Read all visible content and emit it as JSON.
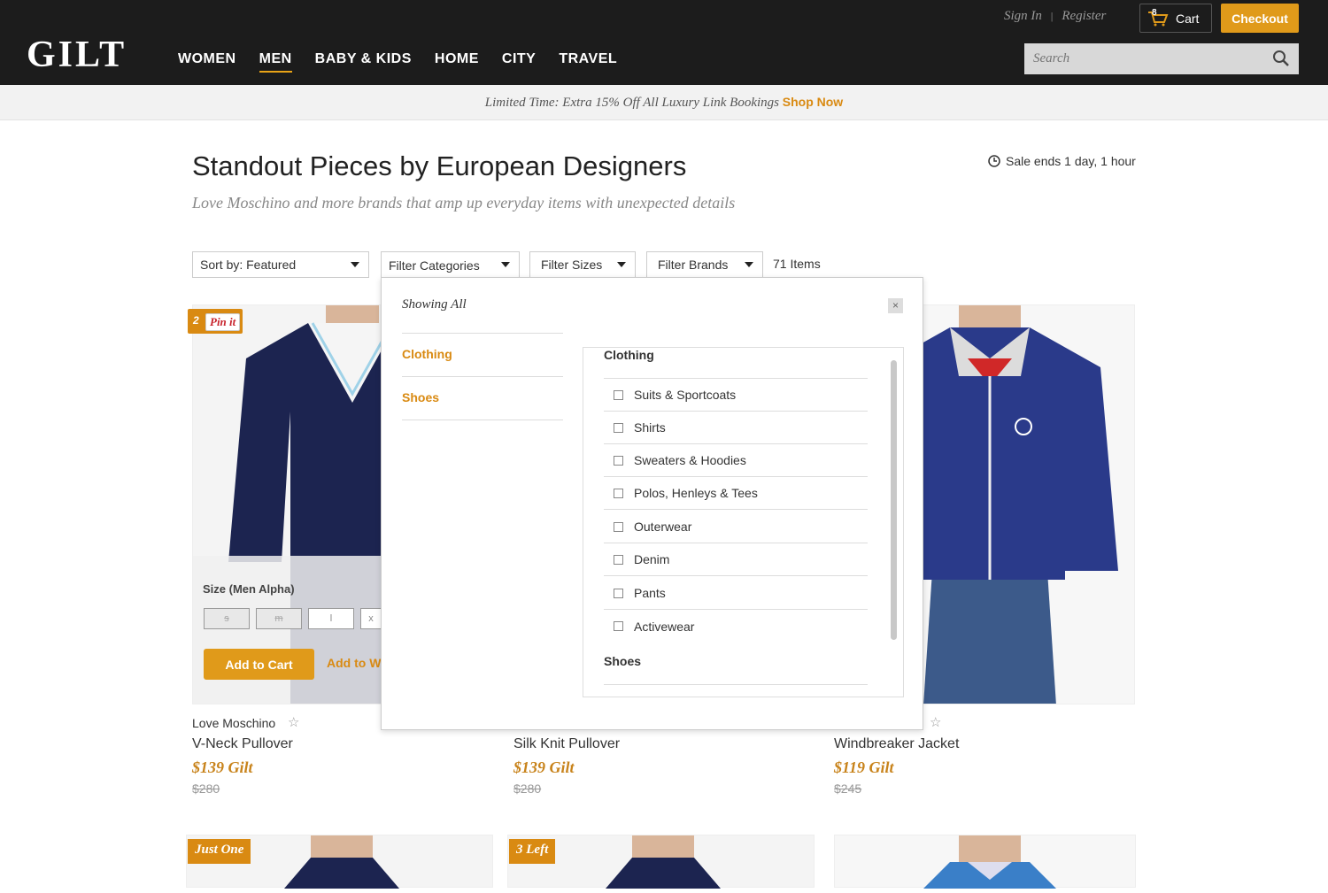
{
  "header": {
    "logo": "GILT",
    "nav": [
      "WOMEN",
      "MEN",
      "BABY & KIDS",
      "HOME",
      "CITY",
      "TRAVEL"
    ],
    "active_nav": "MEN",
    "sign_in": "Sign In",
    "register": "Register",
    "separator": "|",
    "cart_count": "8",
    "cart_label": "Cart",
    "checkout": "Checkout",
    "search_placeholder": "Search"
  },
  "promo": {
    "text": "Limited Time: Extra 15% Off All Luxury Link Bookings",
    "link": "Shop Now"
  },
  "sale": {
    "title": "Standout Pieces by European Designers",
    "subtitle": "Love Moschino and more brands that amp up everyday items with unexpected details",
    "ends": "Sale ends 1 day, 1 hour"
  },
  "filters": {
    "sort": "Sort by: Featured",
    "categories": "Filter Categories",
    "sizes": "Filter Sizes",
    "brands": "Filter Brands",
    "item_count": "71 Items"
  },
  "panel": {
    "showing": "Showing All",
    "close": "×",
    "left_categories": [
      "Clothing",
      "Shoes"
    ],
    "group_clothing": "Clothing",
    "clothing_items": [
      "Suits & Sportcoats",
      "Shirts",
      "Sweaters & Hoodies",
      "Polos, Henleys & Tees",
      "Outerwear",
      "Denim",
      "Pants",
      "Activewear"
    ],
    "group_shoes": "Shoes"
  },
  "card1": {
    "pin_count": "2",
    "pin_label": "Pin it",
    "size_label": "Size (Men Alpha)",
    "sizes": [
      "s",
      "m",
      "l",
      "x"
    ],
    "add_to_cart": "Add to Cart",
    "add_to_wishlist": "Add to Wishlist"
  },
  "products": [
    {
      "brand": "Love Moschino",
      "name": "V-Neck Pullover",
      "price": "$139 Gilt",
      "original": "$280"
    },
    {
      "brand": "",
      "name": "Silk Knit Pullover",
      "price": "$139 Gilt",
      "original": "$280"
    },
    {
      "brand": "",
      "name": "Windbreaker Jacket",
      "price": "$119 Gilt",
      "original": "$245"
    }
  ],
  "badges": [
    "Just One",
    "3 Left"
  ],
  "colors": {
    "accent": "#e09a1a",
    "header_bg": "#1c1c1c"
  }
}
